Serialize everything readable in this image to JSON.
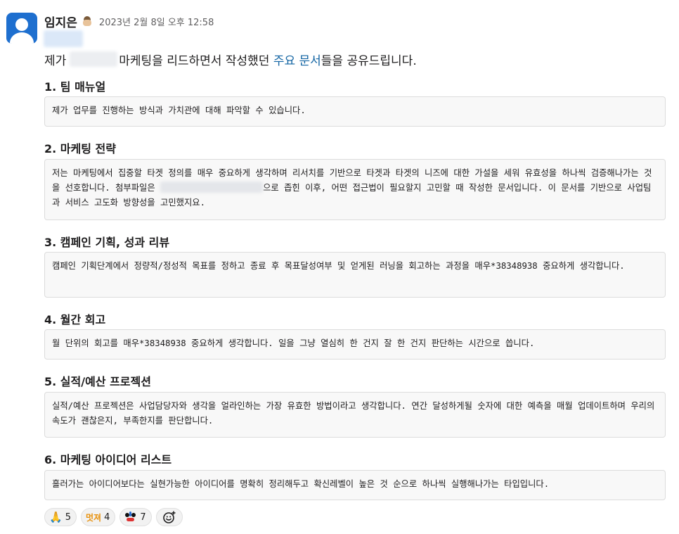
{
  "message": {
    "sender": "임지은",
    "status_emoji": "hat-face-emoji",
    "timestamp": "2023년 2월 8일 오후 12:58",
    "intro": {
      "before": "제가",
      "after": "마케팅을 리드하면서 작성했던",
      "link": "주요 문서",
      "end": "들을 공유드립니다."
    },
    "sections": [
      {
        "title": "1. 팀 매뉴얼",
        "body": "제가 업무를 진행하는 방식과 가치관에 대해 파악할 수 있습니다."
      },
      {
        "title": "2. 마케팅 전략",
        "body_before": "저는 마케팅에서 집중할 타겟 정의를 매우 중요하게 생각하며 리서치를 기반으로 타겟과 타겟의 니즈에 대한 가설을 세워 유효성을 하나씩 검증해나가는 것을 선호합니다. 첨부파일은",
        "body_after": "으로 좁힌 이후, 어떤 접근법이 필요할지 고민할 때 작성한 문서입니다. 이 문서를 기반으로 사업팀과 서비스 고도화 방향성을 고민했지요."
      },
      {
        "title": "3. 캠페인 기획, 성과 리뷰",
        "body": "캠페인 기획단계에서 정량적/정성적 목표를 정하고 종료 후 목표달성여부 및 얻게된 러닝을 회고하는 과정을 매우*38348938 중요하게 생각합니다."
      },
      {
        "title": "4. 월간 회고",
        "body": "월 단위의 회고를 매우*38348938 중요하게 생각합니다. 일을 그냥 열심히 한 건지 잘 한 건지 판단하는 시간으로 씁니다."
      },
      {
        "title": "5. 실적/예산 프로젝션",
        "body": "실적/예산 프로젝션은 사업담당자와 생각을 얼라인하는 가장 유효한 방법이라고 생각합니다. 연간 달성하게될 숫자에 대한 예측을 매월 업데이트하며 우리의 속도가 괜찮은지, 부족한지를 판단합니다."
      },
      {
        "title": "6. 마케팅 아이디어 리스트",
        "body": "흘러가는 아이디어보다는 실현가능한 아이디어를 명확히 정리해두고 확신레벨이 높은 것 순으로 하나씩 실행해나가는 타입입니다."
      }
    ],
    "reactions": [
      {
        "icon": "folded-hands-emoji",
        "glyph": "🙏",
        "count": "5"
      },
      {
        "icon": "meotjyeo-text-emoji",
        "glyph": "멋져",
        "count": "4"
      },
      {
        "icon": "cartoon-face-emoji",
        "count": "7"
      }
    ],
    "add_reaction_icon": "add-reaction-smiley-icon"
  },
  "colors": {
    "link": "#1264a3",
    "avatar": "#1e6fcf",
    "code_bg": "#f8f8f8",
    "text": "#1d1c1d",
    "muted": "#616061"
  }
}
